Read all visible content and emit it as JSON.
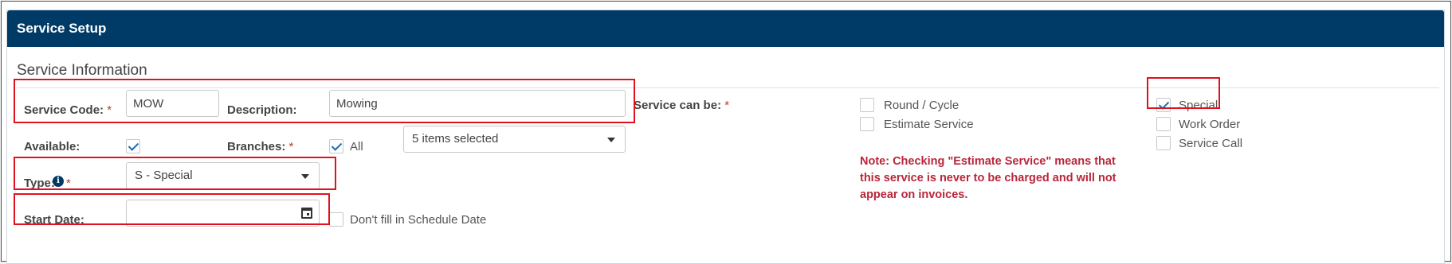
{
  "header": {
    "title": "Service Setup"
  },
  "section": {
    "title": "Service Information"
  },
  "fields": {
    "service_code": {
      "label": "Service Code:",
      "required": "*",
      "value": "MOW"
    },
    "description": {
      "label": "Description:",
      "value": "Mowing"
    },
    "available": {
      "label": "Available:",
      "checked": true
    },
    "branches": {
      "label": "Branches:",
      "required": "*",
      "all_label": "All",
      "all_checked": true,
      "selected": "5 items selected"
    },
    "type": {
      "label": "Type:",
      "required": "*",
      "value": "S - Special"
    },
    "start_date": {
      "label": "Start Date:",
      "value": "",
      "dont_fill_label": "Don't fill in Schedule Date",
      "dont_fill_checked": false
    }
  },
  "service_can_be": {
    "label": "Service can be:",
    "required": "*",
    "options": [
      {
        "label": "Round / Cycle",
        "checked": false
      },
      {
        "label": "Estimate Service",
        "checked": false
      },
      {
        "label": "Special",
        "checked": true
      },
      {
        "label": "Work Order",
        "checked": false
      },
      {
        "label": "Service Call",
        "checked": false
      }
    ],
    "note": "Note: Checking \"Estimate Service\" means that this service is never to be charged and will not appear on invoices."
  },
  "colors": {
    "header_bg": "#003a66",
    "highlight": "#e0121f",
    "note": "#b8263a",
    "check": "#1a6fb5"
  }
}
